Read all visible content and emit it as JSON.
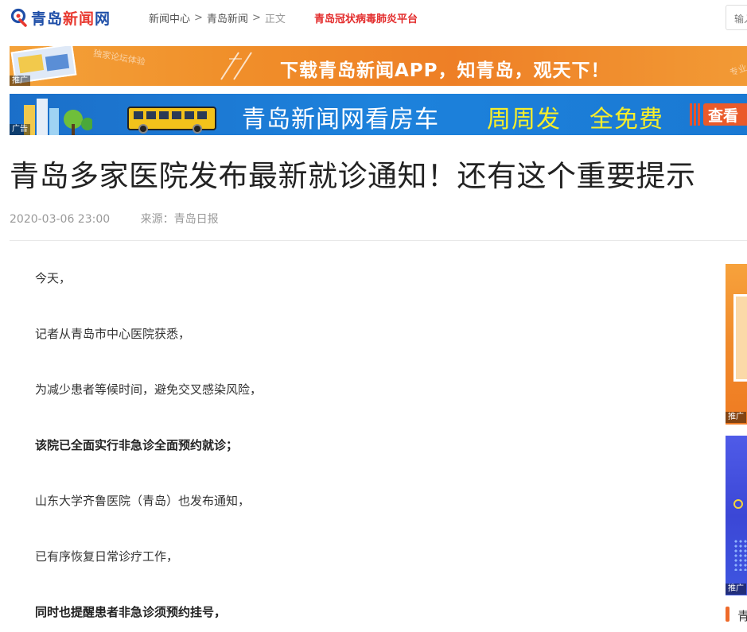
{
  "header": {
    "logo": {
      "part1": "青岛",
      "part2": "新闻",
      "part3": "网"
    },
    "breadcrumb": [
      {
        "label": "新闻中心"
      },
      {
        "label": "青岛新闻"
      },
      {
        "label": "正文"
      }
    ],
    "breadcrumb_separator": ">",
    "covid_link": "青岛冠状病毒肺炎平台",
    "search_placeholder": "输入"
  },
  "banners": {
    "app_banner": {
      "tag": "推广",
      "faint_text": "独家论坛体验",
      "tagline": "下载青岛新闻APP，知青岛，观天下！",
      "right_faint": "专业"
    },
    "car_banner": {
      "tag": "广告",
      "slogan1": "青岛新闻网看房车",
      "slogan2": "周周发",
      "slogan3": "全免费",
      "cta": "查看"
    }
  },
  "article": {
    "title": "青岛多家医院发布最新就诊通知！还有这个重要提示",
    "date": "2020-03-06 23:00",
    "source": "来源：青岛日报",
    "paragraphs": [
      {
        "text": "今天，",
        "bold": false
      },
      {
        "text": "记者从青岛市中心医院获悉，",
        "bold": false
      },
      {
        "text": "为减少患者等候时间，避免交叉感染风险，",
        "bold": false
      },
      {
        "text": "该院已全面实行非急诊全面预约就诊；",
        "bold": true
      },
      {
        "text": "山东大学齐鲁医院（青岛）也发布通知，",
        "bold": false
      },
      {
        "text": "已有序恢复日常诊疗工作，",
        "bold": false
      },
      {
        "text": "同时也提醒患者非急诊须预约挂号，",
        "bold": true
      }
    ]
  },
  "sidebar": {
    "ad1_tag": "推广",
    "ad2_tag": "推广",
    "section_text": "青"
  },
  "colors": {
    "brand_blue": "#1f4fa8",
    "brand_red": "#e8382f",
    "covid_red": "#e32c2c",
    "banner_orange": "#f08f2a",
    "banner_blue": "#1d82dc",
    "slogan_yellow": "#f7ee2b"
  }
}
